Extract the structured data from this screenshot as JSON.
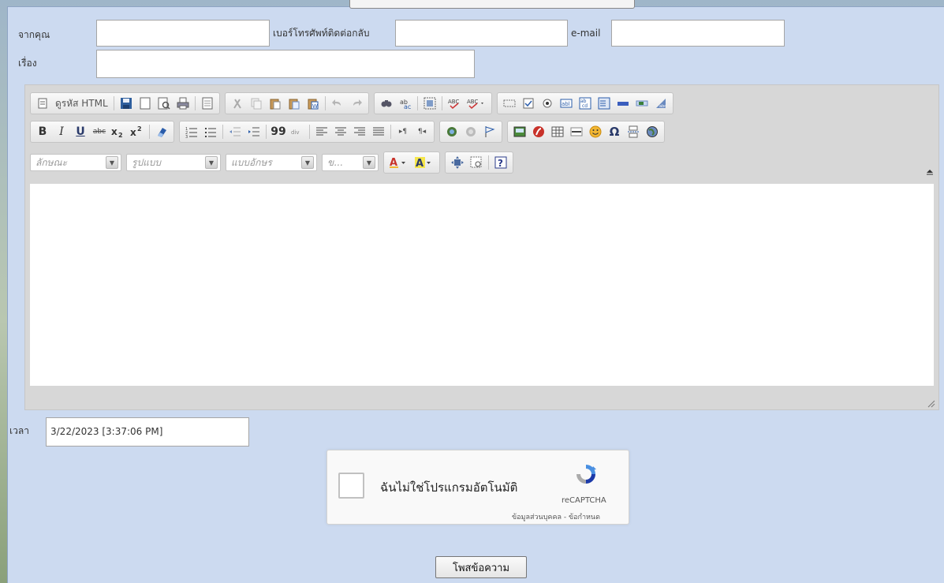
{
  "form": {
    "from_label": "จากคุณ",
    "phone_label": "เบอร์โทรศัพท์ติดต่อกลับ",
    "email_label": "e-mail",
    "subject_label": "เรื่อง",
    "from_value": "",
    "phone_value": "",
    "email_value": "",
    "subject_value": "",
    "time_label": "เวลา",
    "time_value": "3/22/2023 [3:37:06 PM]",
    "submit_label": "โพสข้อความ"
  },
  "editor": {
    "source_label": "ดูรหัส HTML",
    "format_placeholder": "ลักษณะ",
    "style_placeholder": "รูปแบบ",
    "font_placeholder": "แบบอักษร",
    "size_placeholder": "ข..."
  },
  "captcha": {
    "label": "ฉันไม่ใช่โปรแกรมอัตโนมัติ",
    "brand": "reCAPTCHA",
    "links": "ข้อมูลส่วนบุคคล - ข้อกำหนด"
  },
  "colors": {
    "panel": "#ccdaf0",
    "editor_chrome": "#d7d7d7",
    "captcha_blue": "#4a90e2"
  }
}
